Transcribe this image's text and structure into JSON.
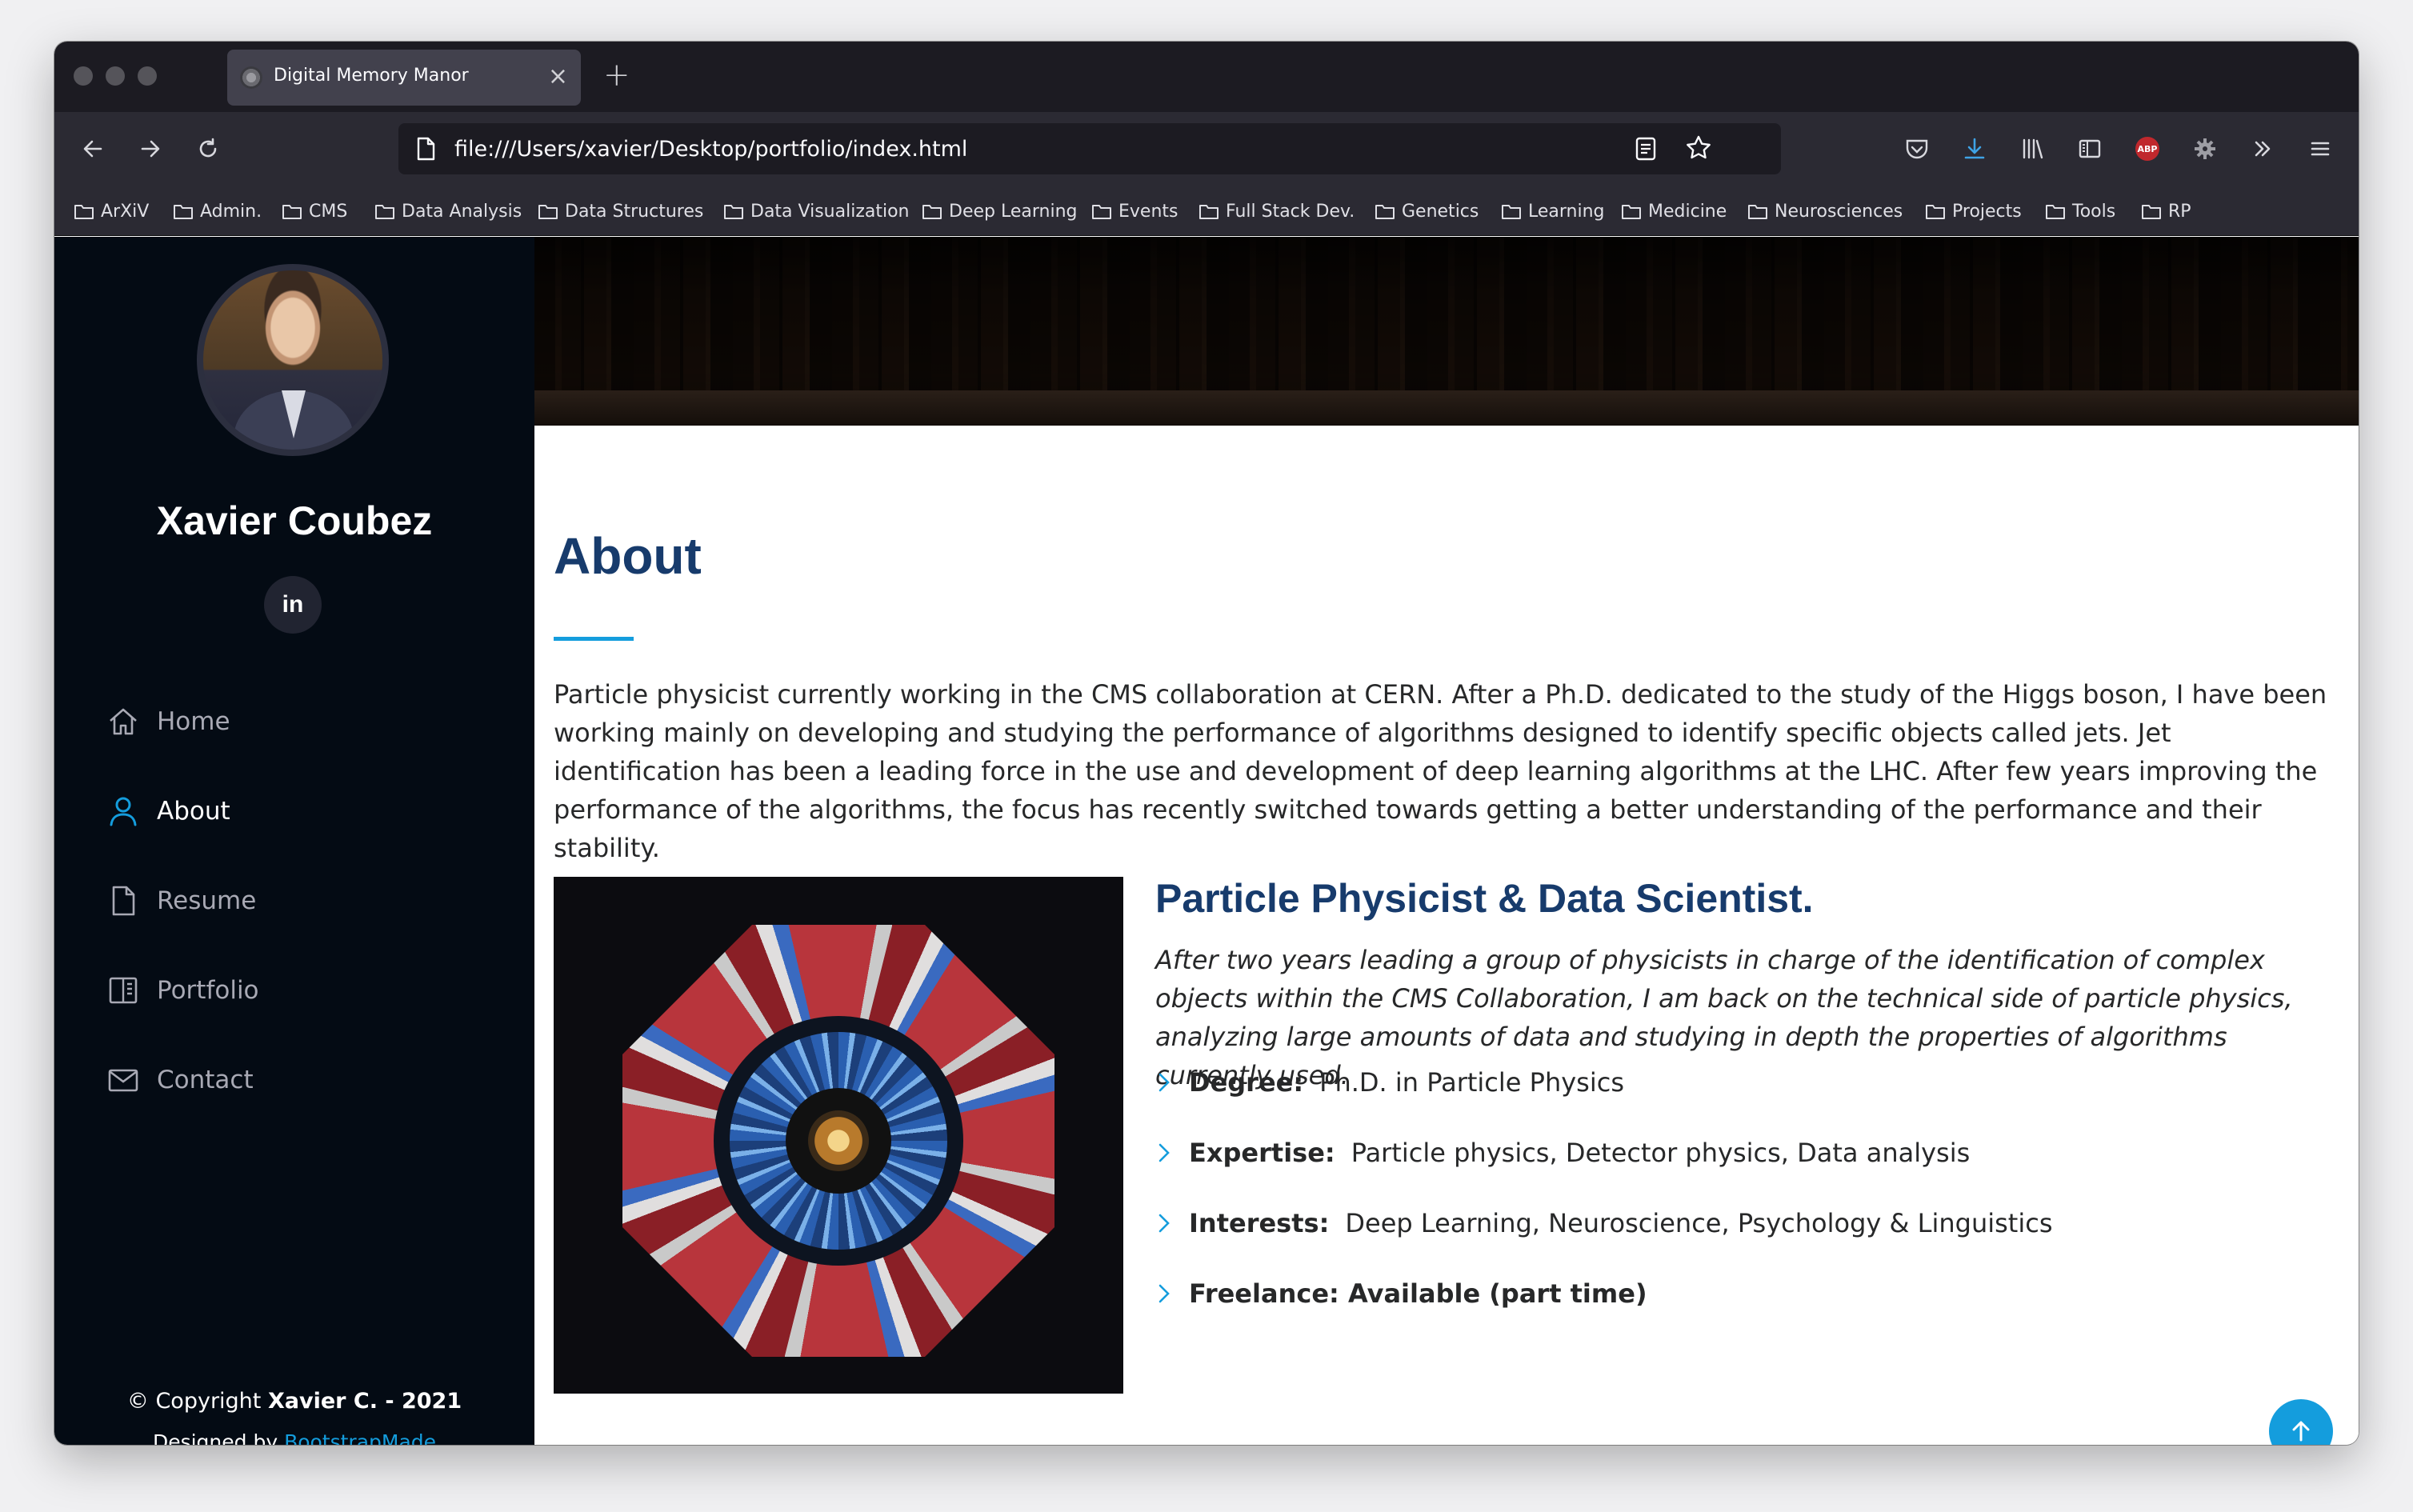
{
  "browser": {
    "tab_title": "Digital Memory Manor",
    "tab_close": "×",
    "new_tab": "+",
    "url": "file:///Users/xavier/Desktop/portfolio/index.html",
    "abp_label": "ABP",
    "bookmarks": [
      "ArXiV",
      "Admin.",
      "CMS",
      "Data Analysis",
      "Data Structures",
      "Data Visualization",
      "Deep Learning",
      "Events",
      "Full Stack Dev.",
      "Genetics",
      "Learning",
      "Medicine",
      "Neurosciences",
      "Projects",
      "Tools",
      "RP"
    ]
  },
  "sidebar": {
    "name": "Xavier Coubez",
    "social": "in",
    "nav": [
      {
        "label": "Home",
        "icon": "home-icon"
      },
      {
        "label": "About",
        "icon": "person-icon",
        "active": true
      },
      {
        "label": "Resume",
        "icon": "file-icon"
      },
      {
        "label": "Portfolio",
        "icon": "book-icon"
      },
      {
        "label": "Contact",
        "icon": "envelope-icon"
      }
    ],
    "copyright_prefix": "© Copyright ",
    "copyright_owner": "Xavier C. - 2021",
    "designed_prefix": "Designed by ",
    "designed_link": "BootstrapMade"
  },
  "about": {
    "title": "About",
    "text": "Particle physicist currently working in the CMS collaboration at CERN. After a Ph.D. dedicated to the study of the Higgs boson, I have been working mainly on developing and studying the performance of algorithms designed to identify specific objects called jets. Jet identification has been a leading force in the use and development of deep learning algorithms at the LHC. After few years improving the performance of the algorithms, the focus has recently switched towards getting a better understanding of the performance and their stability.",
    "headline": "Particle Physicist & Data Scientist.",
    "intro": "After two years leading a group of physicists in charge of the identification of complex objects within the CMS Collaboration, I am back on the technical side of particle physics, analyzing large amounts of data and studying in depth the properties of algorithms currently used.",
    "facts": [
      {
        "label": "Degree:",
        "value": "Ph.D. in Particle Physics"
      },
      {
        "label": "Expertise:",
        "value": "Particle physics, Detector physics, Data analysis"
      },
      {
        "label": "Interests:",
        "value": "Deep Learning, Neuroscience, Psychology & Linguistics"
      },
      {
        "label": "Freelance: Available (part time)",
        "value": ""
      }
    ]
  },
  "colors": {
    "accent": "#149ddd",
    "heading": "#173b6c",
    "sidebar_bg": "#040b14",
    "body_text": "#272829"
  }
}
